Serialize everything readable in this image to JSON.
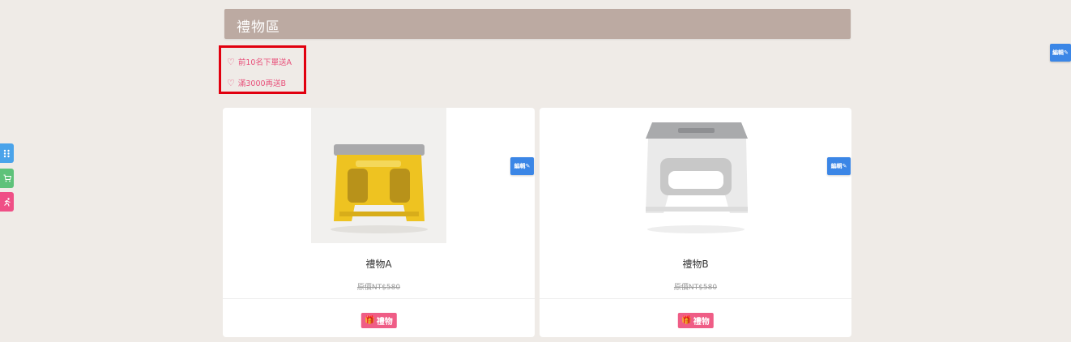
{
  "section": {
    "title": "禮物區"
  },
  "promos": [
    {
      "text": "前10名下單送A"
    },
    {
      "text": "滿3000再送B"
    }
  ],
  "products": [
    {
      "name": "禮物A",
      "price": "原價NT$580",
      "badge": "禮物",
      "stool_color": "yellow"
    },
    {
      "name": "禮物B",
      "price": "原價NT$580",
      "badge": "禮物",
      "stool_color": "white"
    }
  ],
  "edit_label": "編輯",
  "side_nav": [
    {
      "icon": "grid-icon",
      "color": "#4aa3ea"
    },
    {
      "icon": "cart-icon",
      "color": "#5ec27a"
    },
    {
      "icon": "runner-icon",
      "color": "#ef4f86"
    }
  ],
  "colors": {
    "background": "#efebe7",
    "header": "#bcaaa2",
    "accent_pink": "#ef5d86",
    "edit_blue": "#3b86e6",
    "highlight_red": "#e1000f"
  }
}
